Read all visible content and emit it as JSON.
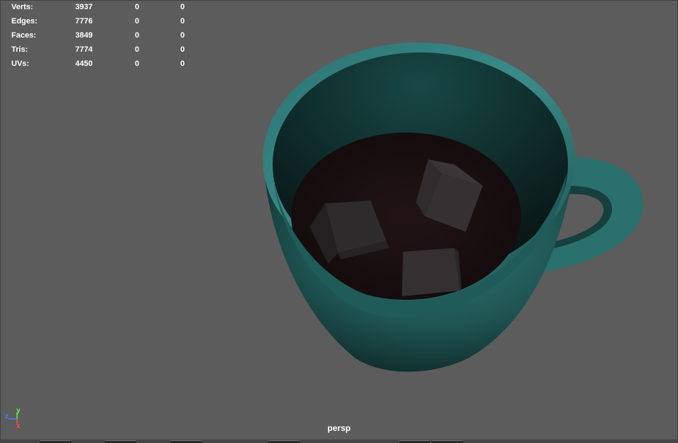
{
  "hud": {
    "rows": [
      {
        "label": "Verts:",
        "v1": "3937",
        "v2": "0",
        "v3": "0"
      },
      {
        "label": "Edges:",
        "v1": "7776",
        "v2": "0",
        "v3": "0"
      },
      {
        "label": "Faces:",
        "v1": "3849",
        "v2": "0",
        "v3": "0"
      },
      {
        "label": "Tris:",
        "v1": "7774",
        "v2": "0",
        "v3": "0"
      },
      {
        "label": "UVs:",
        "v1": "4450",
        "v2": "0",
        "v3": "0"
      }
    ]
  },
  "axis": {
    "y": "y",
    "z": "z",
    "x": "x"
  },
  "camera": {
    "label": "persp"
  },
  "colors": {
    "background": "#5c5c5c",
    "mug": "#2b6e6c",
    "liquid": "#1a0f10"
  }
}
